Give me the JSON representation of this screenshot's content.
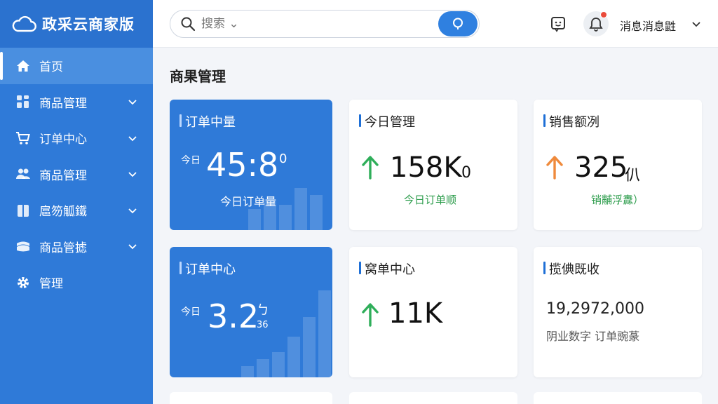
{
  "brand": {
    "name": "政采云商家版"
  },
  "sidebar": {
    "items": [
      {
        "label": "首页",
        "icon": "home-icon",
        "active": true,
        "has_chevron": false
      },
      {
        "label": "商品管理",
        "icon": "grid-icon",
        "active": false,
        "has_chevron": true
      },
      {
        "label": "订单中心",
        "icon": "cart-icon",
        "active": false,
        "has_chevron": true
      },
      {
        "label": "商品管理",
        "icon": "users-icon",
        "active": false,
        "has_chevron": true
      },
      {
        "label": "扈笏觚鐵",
        "icon": "book-icon",
        "active": false,
        "has_chevron": true
      },
      {
        "label": "商品管摅",
        "icon": "stack-icon",
        "active": false,
        "has_chevron": true
      },
      {
        "label": "管理",
        "icon": "gear-icon",
        "active": false,
        "has_chevron": false
      }
    ]
  },
  "header": {
    "search_placeholder": "搜索 ⌄",
    "username": "消息消息鼪"
  },
  "main": {
    "page_title": "商果管理",
    "cards": [
      {
        "title": "订单中量",
        "prefix": "今日",
        "value": "45:8",
        "suffix": "0",
        "sub": "今日订单量"
      },
      {
        "title": "今日管理",
        "value": "158K",
        "suffix": "0",
        "sub": "今日订单顺",
        "arrow_color": "#2fae5a"
      },
      {
        "title": "销售额冽",
        "value": "325",
        "suffix": "仈",
        "sub": "销黼浮纛）",
        "arrow_color": "#ef8a3c"
      },
      {
        "title": "订单中心",
        "prefix": "今日",
        "value": "3.2",
        "suffix": "ㄅ",
        "suffix2": "36"
      },
      {
        "title": "窝单中心",
        "value": "11K",
        "arrow_color": "#2fae5a"
      },
      {
        "title": "揽倎既收",
        "value": "19,297​2,000",
        "sub": "阴业数字 订单豌蒃"
      }
    ]
  },
  "colors": {
    "sidebar": "#2f7ad8",
    "accent": "#2f80e0",
    "up_green": "#2fae5a",
    "up_orange": "#ef8a3c"
  }
}
